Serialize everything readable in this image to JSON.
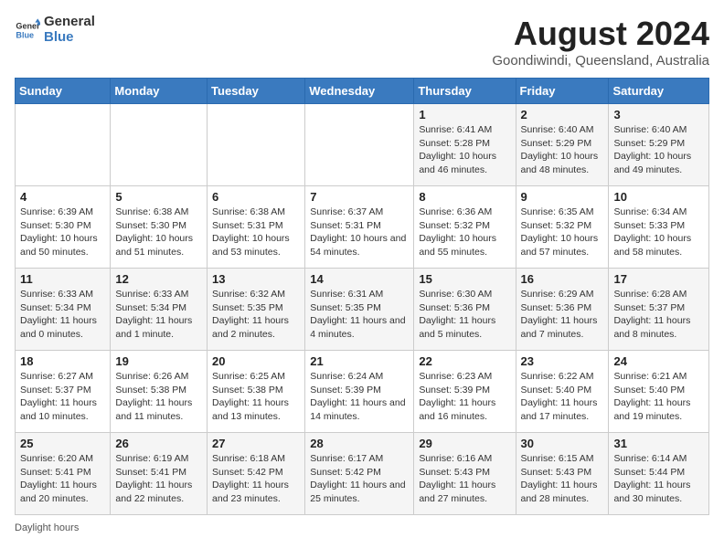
{
  "logo": {
    "general": "General",
    "blue": "Blue"
  },
  "title": "August 2024",
  "subtitle": "Goondiwindi, Queensland, Australia",
  "days_of_week": [
    "Sunday",
    "Monday",
    "Tuesday",
    "Wednesday",
    "Thursday",
    "Friday",
    "Saturday"
  ],
  "footer": {
    "daylight_label": "Daylight hours"
  },
  "weeks": [
    [
      {
        "day": "",
        "info": ""
      },
      {
        "day": "",
        "info": ""
      },
      {
        "day": "",
        "info": ""
      },
      {
        "day": "",
        "info": ""
      },
      {
        "day": "1",
        "info": "Sunrise: 6:41 AM\nSunset: 5:28 PM\nDaylight: 10 hours and 46 minutes."
      },
      {
        "day": "2",
        "info": "Sunrise: 6:40 AM\nSunset: 5:29 PM\nDaylight: 10 hours and 48 minutes."
      },
      {
        "day": "3",
        "info": "Sunrise: 6:40 AM\nSunset: 5:29 PM\nDaylight: 10 hours and 49 minutes."
      }
    ],
    [
      {
        "day": "4",
        "info": "Sunrise: 6:39 AM\nSunset: 5:30 PM\nDaylight: 10 hours and 50 minutes."
      },
      {
        "day": "5",
        "info": "Sunrise: 6:38 AM\nSunset: 5:30 PM\nDaylight: 10 hours and 51 minutes."
      },
      {
        "day": "6",
        "info": "Sunrise: 6:38 AM\nSunset: 5:31 PM\nDaylight: 10 hours and 53 minutes."
      },
      {
        "day": "7",
        "info": "Sunrise: 6:37 AM\nSunset: 5:31 PM\nDaylight: 10 hours and 54 minutes."
      },
      {
        "day": "8",
        "info": "Sunrise: 6:36 AM\nSunset: 5:32 PM\nDaylight: 10 hours and 55 minutes."
      },
      {
        "day": "9",
        "info": "Sunrise: 6:35 AM\nSunset: 5:32 PM\nDaylight: 10 hours and 57 minutes."
      },
      {
        "day": "10",
        "info": "Sunrise: 6:34 AM\nSunset: 5:33 PM\nDaylight: 10 hours and 58 minutes."
      }
    ],
    [
      {
        "day": "11",
        "info": "Sunrise: 6:33 AM\nSunset: 5:34 PM\nDaylight: 11 hours and 0 minutes."
      },
      {
        "day": "12",
        "info": "Sunrise: 6:33 AM\nSunset: 5:34 PM\nDaylight: 11 hours and 1 minute."
      },
      {
        "day": "13",
        "info": "Sunrise: 6:32 AM\nSunset: 5:35 PM\nDaylight: 11 hours and 2 minutes."
      },
      {
        "day": "14",
        "info": "Sunrise: 6:31 AM\nSunset: 5:35 PM\nDaylight: 11 hours and 4 minutes."
      },
      {
        "day": "15",
        "info": "Sunrise: 6:30 AM\nSunset: 5:36 PM\nDaylight: 11 hours and 5 minutes."
      },
      {
        "day": "16",
        "info": "Sunrise: 6:29 AM\nSunset: 5:36 PM\nDaylight: 11 hours and 7 minutes."
      },
      {
        "day": "17",
        "info": "Sunrise: 6:28 AM\nSunset: 5:37 PM\nDaylight: 11 hours and 8 minutes."
      }
    ],
    [
      {
        "day": "18",
        "info": "Sunrise: 6:27 AM\nSunset: 5:37 PM\nDaylight: 11 hours and 10 minutes."
      },
      {
        "day": "19",
        "info": "Sunrise: 6:26 AM\nSunset: 5:38 PM\nDaylight: 11 hours and 11 minutes."
      },
      {
        "day": "20",
        "info": "Sunrise: 6:25 AM\nSunset: 5:38 PM\nDaylight: 11 hours and 13 minutes."
      },
      {
        "day": "21",
        "info": "Sunrise: 6:24 AM\nSunset: 5:39 PM\nDaylight: 11 hours and 14 minutes."
      },
      {
        "day": "22",
        "info": "Sunrise: 6:23 AM\nSunset: 5:39 PM\nDaylight: 11 hours and 16 minutes."
      },
      {
        "day": "23",
        "info": "Sunrise: 6:22 AM\nSunset: 5:40 PM\nDaylight: 11 hours and 17 minutes."
      },
      {
        "day": "24",
        "info": "Sunrise: 6:21 AM\nSunset: 5:40 PM\nDaylight: 11 hours and 19 minutes."
      }
    ],
    [
      {
        "day": "25",
        "info": "Sunrise: 6:20 AM\nSunset: 5:41 PM\nDaylight: 11 hours and 20 minutes."
      },
      {
        "day": "26",
        "info": "Sunrise: 6:19 AM\nSunset: 5:41 PM\nDaylight: 11 hours and 22 minutes."
      },
      {
        "day": "27",
        "info": "Sunrise: 6:18 AM\nSunset: 5:42 PM\nDaylight: 11 hours and 23 minutes."
      },
      {
        "day": "28",
        "info": "Sunrise: 6:17 AM\nSunset: 5:42 PM\nDaylight: 11 hours and 25 minutes."
      },
      {
        "day": "29",
        "info": "Sunrise: 6:16 AM\nSunset: 5:43 PM\nDaylight: 11 hours and 27 minutes."
      },
      {
        "day": "30",
        "info": "Sunrise: 6:15 AM\nSunset: 5:43 PM\nDaylight: 11 hours and 28 minutes."
      },
      {
        "day": "31",
        "info": "Sunrise: 6:14 AM\nSunset: 5:44 PM\nDaylight: 11 hours and 30 minutes."
      }
    ]
  ]
}
